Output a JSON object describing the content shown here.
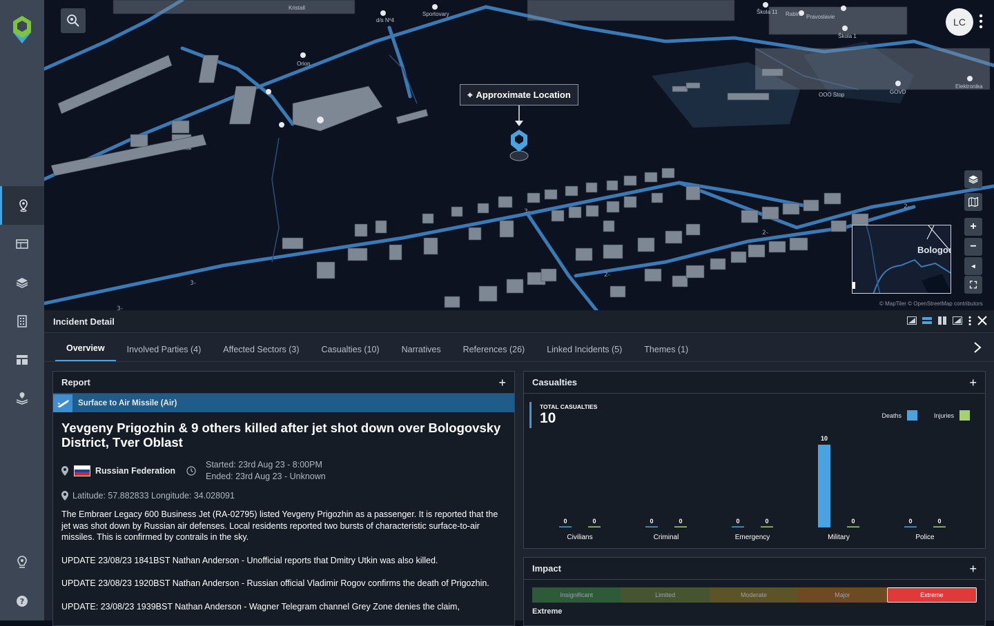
{
  "sidebar": {
    "logo": "location-logo",
    "items": [
      {
        "name": "map-pin",
        "active": true
      },
      {
        "name": "table"
      },
      {
        "name": "layers"
      },
      {
        "name": "building"
      },
      {
        "name": "dashboard"
      },
      {
        "name": "stacked-pin"
      },
      {
        "name": "location-bulb"
      },
      {
        "name": "help"
      }
    ]
  },
  "map": {
    "approx_label": "Approximate Location",
    "avatar": "LC",
    "minimap_label": "Bologoe",
    "attribution": "© MapTiler © OpenStreetMap contributors",
    "labels": [
      "Kristall",
      "Sportovary",
      "Orion",
      "Škola 11",
      "Rabin",
      "Pravoslavie",
      "Škola 1",
      "OOO Stop",
      "GOVD",
      "Elektronika",
      "d/s Nº4"
    ]
  },
  "panel": {
    "title": "Incident Detail",
    "tabs": [
      "Overview",
      "Involved Parties (4)",
      "Affected Sectors (3)",
      "Casualties (10)",
      "Narratives",
      "References (26)",
      "Linked Incidents (5)",
      "Themes (1)"
    ]
  },
  "report": {
    "title": "Report",
    "type": "Surface to Air Missile (Air)",
    "headline": "Yevgeny Prigozhin & 9 others killed after jet shot down over Bologovsky District, Tver Oblast",
    "country": "Russian Federation",
    "started": "Started: 23rd Aug 23 - 8:00PM",
    "ended": "Ended: 23rd Aug 23 - Unknown",
    "latlon": "Latitude: 57.882833 Longitude: 34.028091",
    "paragraphs": [
      "The Embraer Legacy 600 Business Jet (RA-02795) listed Yevgeny Prigozhin as a passenger. It is reported that the jet was shot down by Russian air defenses. Local residents reported two bursts of characteristic surface-to-air missiles. This is confirmed by contrails in the sky.",
      "UPDATE 23/08/23 1841BST Nathan Anderson - Unofficial reports that Dmitry Utkin was also killed.",
      "UPDATE 23/08/23 1920BST Nathan Anderson - Russian official Vladimir Rogov confirms the death of Prigozhin.",
      "UPDATE: 23/08/23 1939BST Nathan Anderson - Wagner Telegram channel Grey Zone denies the claim,"
    ]
  },
  "casualties": {
    "title": "Casualties",
    "total_label": "TOTAL CASUALTIES",
    "total": "10",
    "legend": {
      "deaths": "Deaths",
      "injuries": "Injuries"
    },
    "colors": {
      "deaths": "#4aa3df",
      "injuries": "#a3d36a"
    }
  },
  "chart_data": {
    "type": "bar",
    "categories": [
      "Civilians",
      "Criminal",
      "Emergency",
      "Military",
      "Police"
    ],
    "series": [
      {
        "name": "Deaths",
        "values": [
          0,
          0,
          0,
          10,
          0
        ]
      },
      {
        "name": "Injuries",
        "values": [
          0,
          0,
          0,
          0,
          0
        ]
      }
    ],
    "ylim": [
      0,
      10
    ]
  },
  "impact": {
    "title": "Impact",
    "levels": [
      "Insignificant",
      "Limited",
      "Moderate",
      "Major",
      "Extreme"
    ],
    "colors": [
      "#2e5a3a",
      "#46552f",
      "#5c5326",
      "#6e4a22",
      "#e0393a"
    ],
    "selected": 4,
    "value": "Extreme"
  }
}
